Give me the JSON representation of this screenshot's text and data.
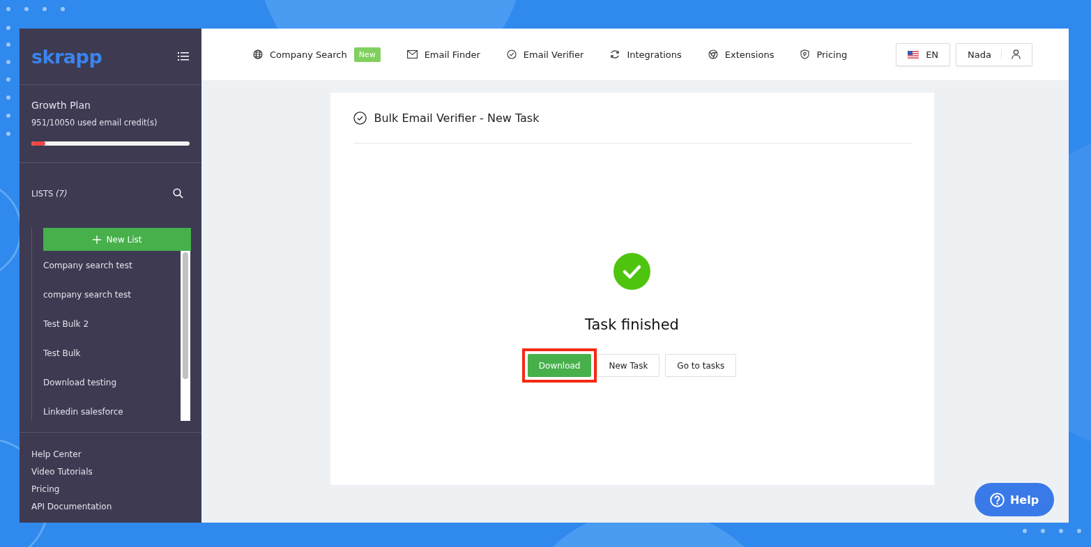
{
  "sidebar": {
    "logo": "skrapp",
    "plan": {
      "name": "Growth Plan",
      "usage": "951/10050 used email credit(s)",
      "level": 0.09
    },
    "lists": {
      "label": "LISTS",
      "count": "(7)",
      "new_button": "New List",
      "items": [
        {
          "label": "Company search test"
        },
        {
          "label": "company search test"
        },
        {
          "label": "Test Bulk 2"
        },
        {
          "label": "Test Bulk"
        },
        {
          "label": "Download testing"
        },
        {
          "label": "Linkedin salesforce"
        }
      ]
    },
    "links": [
      "Help Center",
      "Video Tutorials",
      "Pricing",
      "API Documentation"
    ]
  },
  "nav": {
    "items": [
      {
        "label": "Company Search",
        "badge": "New"
      },
      {
        "label": "Email Finder"
      },
      {
        "label": "Email Verifier"
      },
      {
        "label": "Integrations"
      },
      {
        "label": "Extensions"
      },
      {
        "label": "Pricing"
      }
    ],
    "language": "EN",
    "user": "Nada"
  },
  "card": {
    "title": "Bulk Email Verifier - New Task",
    "status": "Task finished",
    "buttons": [
      {
        "label": "Download",
        "kind": "primary",
        "highlighted": true
      },
      {
        "label": "New Task",
        "kind": "secondary",
        "highlighted": false
      },
      {
        "label": "Go to tasks",
        "kind": "secondary",
        "highlighted": false
      }
    ]
  },
  "help_button": "Help"
}
